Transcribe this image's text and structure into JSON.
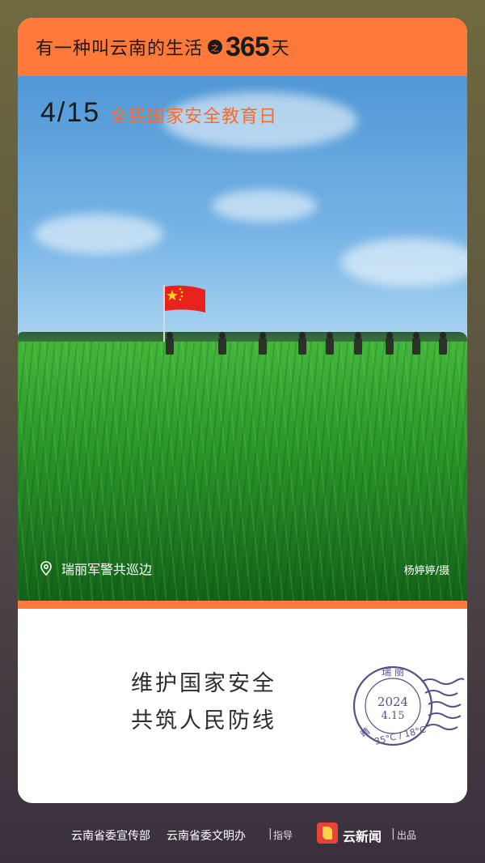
{
  "header": {
    "title": "有一种叫云南的生活",
    "zhi": "之",
    "number": "365",
    "unit": "天"
  },
  "photo": {
    "date": "4/15",
    "event": "全民国家安全教育日",
    "location": "瑞丽军警共巡边",
    "credit": "杨婷婷/摄"
  },
  "slogan": {
    "line1": "维护国家安全",
    "line2": "共筑人民防线"
  },
  "postmark": {
    "place": "瑞 丽",
    "year": "2024",
    "date": "4.15",
    "weather": "晴",
    "temp": "35°C / 18°C"
  },
  "footer": {
    "org1": "云南省委宣传部",
    "org2": "云南省委文明办",
    "sep": "|",
    "guide": "指导",
    "brand": "云新闻",
    "produce": "出品"
  },
  "colors": {
    "accent": "#ff7a3a",
    "event_text": "#ff6a2b",
    "postmark": "#5a4e88"
  }
}
